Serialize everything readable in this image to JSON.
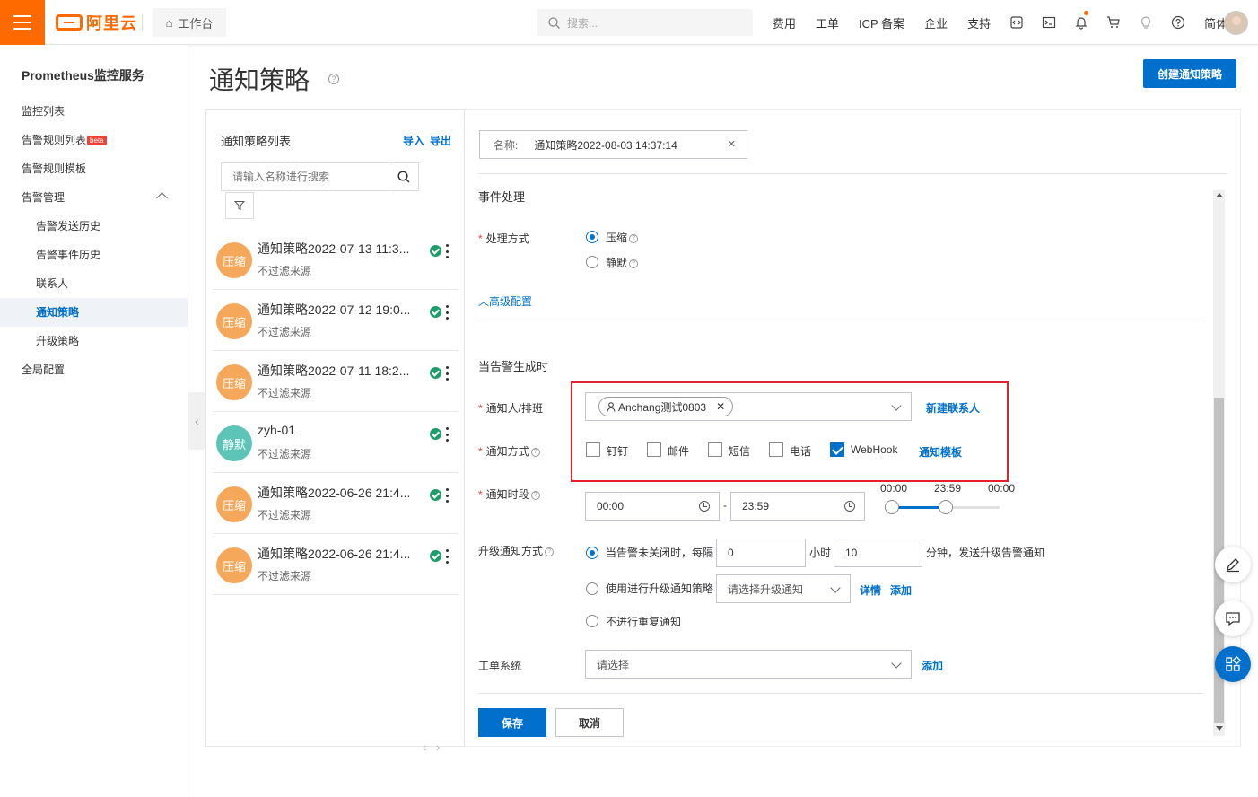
{
  "topbar": {
    "logo_text": "阿里云",
    "workbench": "工作台",
    "search_placeholder": "搜索...",
    "nav": [
      "费用",
      "工单",
      "ICP 备案",
      "企业",
      "支持"
    ],
    "lang": "简体"
  },
  "sidebar": {
    "title": "Prometheus监控服务",
    "items": [
      {
        "label": "监控列表"
      },
      {
        "label": "告警规则列表",
        "badge": "beta"
      },
      {
        "label": "告警规则模板"
      },
      {
        "label": "告警管理"
      },
      {
        "label": "告警发送历史"
      },
      {
        "label": "告警事件历史"
      },
      {
        "label": "联系人"
      },
      {
        "label": "通知策略"
      },
      {
        "label": "升级策略"
      },
      {
        "label": "全局配置"
      }
    ]
  },
  "header": {
    "title": "通知策略",
    "help": "?",
    "create_button": "创建通知策略"
  },
  "list": {
    "title": "通知策略列表",
    "import": "导入",
    "export": "导出",
    "search_placeholder": "请输入名称进行搜索",
    "items": [
      {
        "badge": "压缩",
        "name": "通知策略2022-07-13 11:3...",
        "sub": "不过滤来源",
        "color": "#f5a85a"
      },
      {
        "badge": "压缩",
        "name": "通知策略2022-07-12 19:0...",
        "sub": "不过滤来源",
        "color": "#f5a85a"
      },
      {
        "badge": "压缩",
        "name": "通知策略2022-07-11 18:2...",
        "sub": "不过滤来源",
        "color": "#f5a85a"
      },
      {
        "badge": "静默",
        "name": "zyh-01",
        "sub": "不过滤来源",
        "color": "#5cc5b8"
      },
      {
        "badge": "压缩",
        "name": "通知策略2022-06-26 21:4...",
        "sub": "不过滤来源",
        "color": "#f5a85a"
      },
      {
        "badge": "压缩",
        "name": "通知策略2022-06-26 21:4...",
        "sub": "不过滤来源",
        "color": "#f5a85a"
      }
    ]
  },
  "form": {
    "name_label": "名称:",
    "name_value": "通知策略2022-08-03 14:37:14",
    "event_section": "事件处理",
    "handle_label": "处理方式",
    "handle_options": [
      "压缩",
      "静默"
    ],
    "advanced": "高级配置",
    "alert_section": "当告警生成时",
    "notify_person_label": "通知人/排班",
    "notify_person_tag": "Anchang测试0803",
    "new_contact": "新建联系人",
    "notify_method_label": "通知方式",
    "methods": [
      {
        "label": "钉钉",
        "checked": false
      },
      {
        "label": "邮件",
        "checked": false
      },
      {
        "label": "短信",
        "checked": false
      },
      {
        "label": "电话",
        "checked": false
      },
      {
        "label": "WebHook",
        "checked": true
      }
    ],
    "notify_template": "通知模板",
    "period_label": "通知时段",
    "period_start": "00:00",
    "period_dash": "-",
    "period_end": "23:59",
    "slider_labels": [
      "00:00",
      "23:59",
      "00:00"
    ],
    "slider_value": {
      "start_hours": 0,
      "end_hours": 23.98,
      "max_hours": 48
    },
    "escalate_label": "升级通知方式",
    "escalate_opt1_prefix": "当告警未关闭时，每隔",
    "escalate_hours": "0",
    "hours_unit": "小时",
    "escalate_minutes": "10",
    "escalate_opt1_suffix": "分钟，发送升级告警通知",
    "escalate_opt2": "使用进行升级通知策略",
    "escalate_select_placeholder": "请选择升级通知",
    "details": "详情",
    "add": "添加",
    "escalate_opt3": "不进行重复通知",
    "ticket_label": "工单系统",
    "ticket_placeholder": "请选择",
    "ticket_add": "添加",
    "save": "保存",
    "cancel": "取消"
  }
}
